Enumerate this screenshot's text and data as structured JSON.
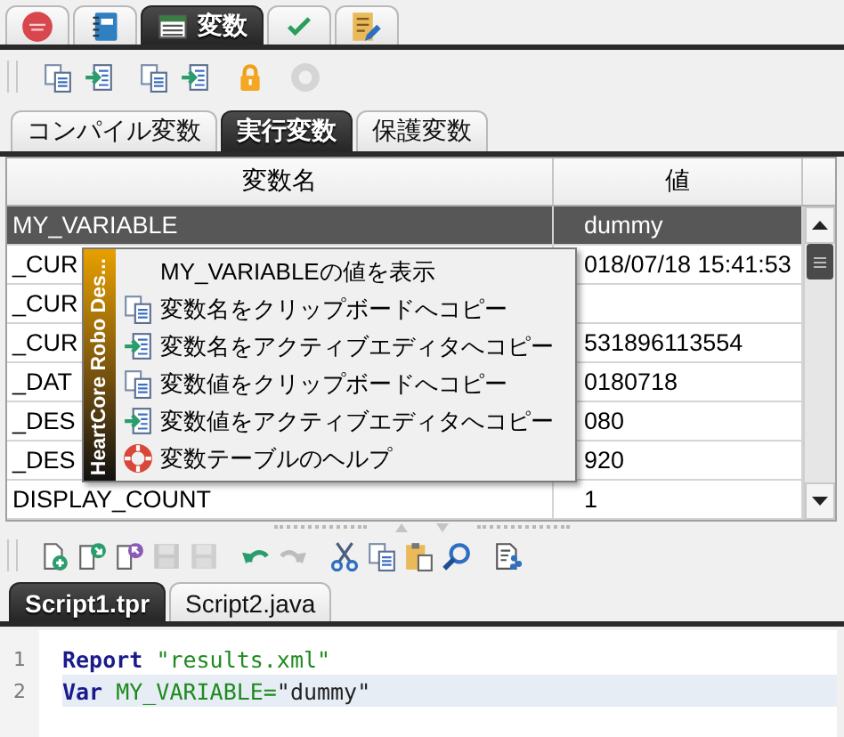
{
  "top_tabs": [
    {
      "kind": "logo",
      "selected": false
    },
    {
      "kind": "notebook",
      "selected": false
    },
    {
      "kind": "table",
      "label": "変数",
      "selected": true
    },
    {
      "kind": "check",
      "selected": false
    },
    {
      "kind": "edit",
      "selected": false
    }
  ],
  "variable_toolbar": [
    {
      "kind": "copy",
      "disabled": false
    },
    {
      "kind": "insert",
      "disabled": false
    },
    {
      "kind": "copy",
      "disabled": false
    },
    {
      "kind": "insert",
      "disabled": false
    },
    {
      "kind": "lock",
      "disabled": false
    },
    {
      "kind": "disc",
      "disabled": true
    }
  ],
  "variable_tabs": [
    {
      "label": "コンパイル変数",
      "selected": false
    },
    {
      "label": "実行変数",
      "selected": true
    },
    {
      "label": "保護変数",
      "selected": false
    }
  ],
  "table": {
    "columns": [
      "変数名",
      "値"
    ],
    "rows": [
      {
        "name": "MY_VARIABLE",
        "value": "dummy",
        "selected": true
      },
      {
        "name": "_CUR",
        "value": "018/07/18 15:41:53",
        "selected": false
      },
      {
        "name": "_CUR",
        "selected": false
      },
      {
        "name": "_CUR",
        "value": "531896113554",
        "selected": false
      },
      {
        "name": "_DAT",
        "value": "0180718",
        "selected": false
      },
      {
        "name": "_DES",
        "value": "080",
        "selected": false
      },
      {
        "name": "_DES",
        "value": "920",
        "selected": false
      },
      {
        "name": "DISPLAY_COUNT",
        "value": "1",
        "selected": false
      }
    ]
  },
  "context_menu": {
    "band": "HeartCore Robo Des...",
    "items": [
      {
        "kind": "plain",
        "label": "MY_VARIABLEの値を表示"
      },
      {
        "kind": "copy",
        "label": "変数名をクリップボードへコピー"
      },
      {
        "kind": "insert",
        "label": "変数名をアクティブエディタへコピー"
      },
      {
        "kind": "copy",
        "label": "変数値をクリップボードへコピー"
      },
      {
        "kind": "insert",
        "label": "変数値をアクティブエディタへコピー"
      },
      {
        "kind": "help",
        "label": "変数テーブルのヘルプ"
      }
    ]
  },
  "editor_toolbar": [
    {
      "kind": "new",
      "disabled": false
    },
    {
      "kind": "import",
      "disabled": false
    },
    {
      "kind": "export",
      "disabled": false
    },
    {
      "kind": "save",
      "disabled": true
    },
    {
      "kind": "saveall",
      "disabled": true
    },
    {
      "kind": "undo",
      "disabled": false
    },
    {
      "kind": "redo",
      "disabled": true
    },
    {
      "kind": "cut",
      "disabled": false
    },
    {
      "kind": "copy",
      "disabled": false
    },
    {
      "kind": "paste",
      "disabled": false
    },
    {
      "kind": "search",
      "disabled": false
    },
    {
      "kind": "script",
      "disabled": false
    }
  ],
  "editor_tabs": [
    {
      "label": "Script1.tpr",
      "selected": true
    },
    {
      "label": "Script2.java",
      "selected": false
    }
  ],
  "editor_lines": [
    {
      "number": "1",
      "current": false,
      "tokens": [
        {
          "kind": "keyword",
          "text": "Report "
        },
        {
          "kind": "string",
          "text": "\"results.xml\""
        }
      ]
    },
    {
      "number": "2",
      "current": true,
      "tokens": [
        {
          "kind": "keyword",
          "text": "Var "
        },
        {
          "kind": "ident",
          "text": "MY_VARIABLE="
        },
        {
          "kind": "plain",
          "text": "\"dummy\""
        }
      ]
    }
  ]
}
